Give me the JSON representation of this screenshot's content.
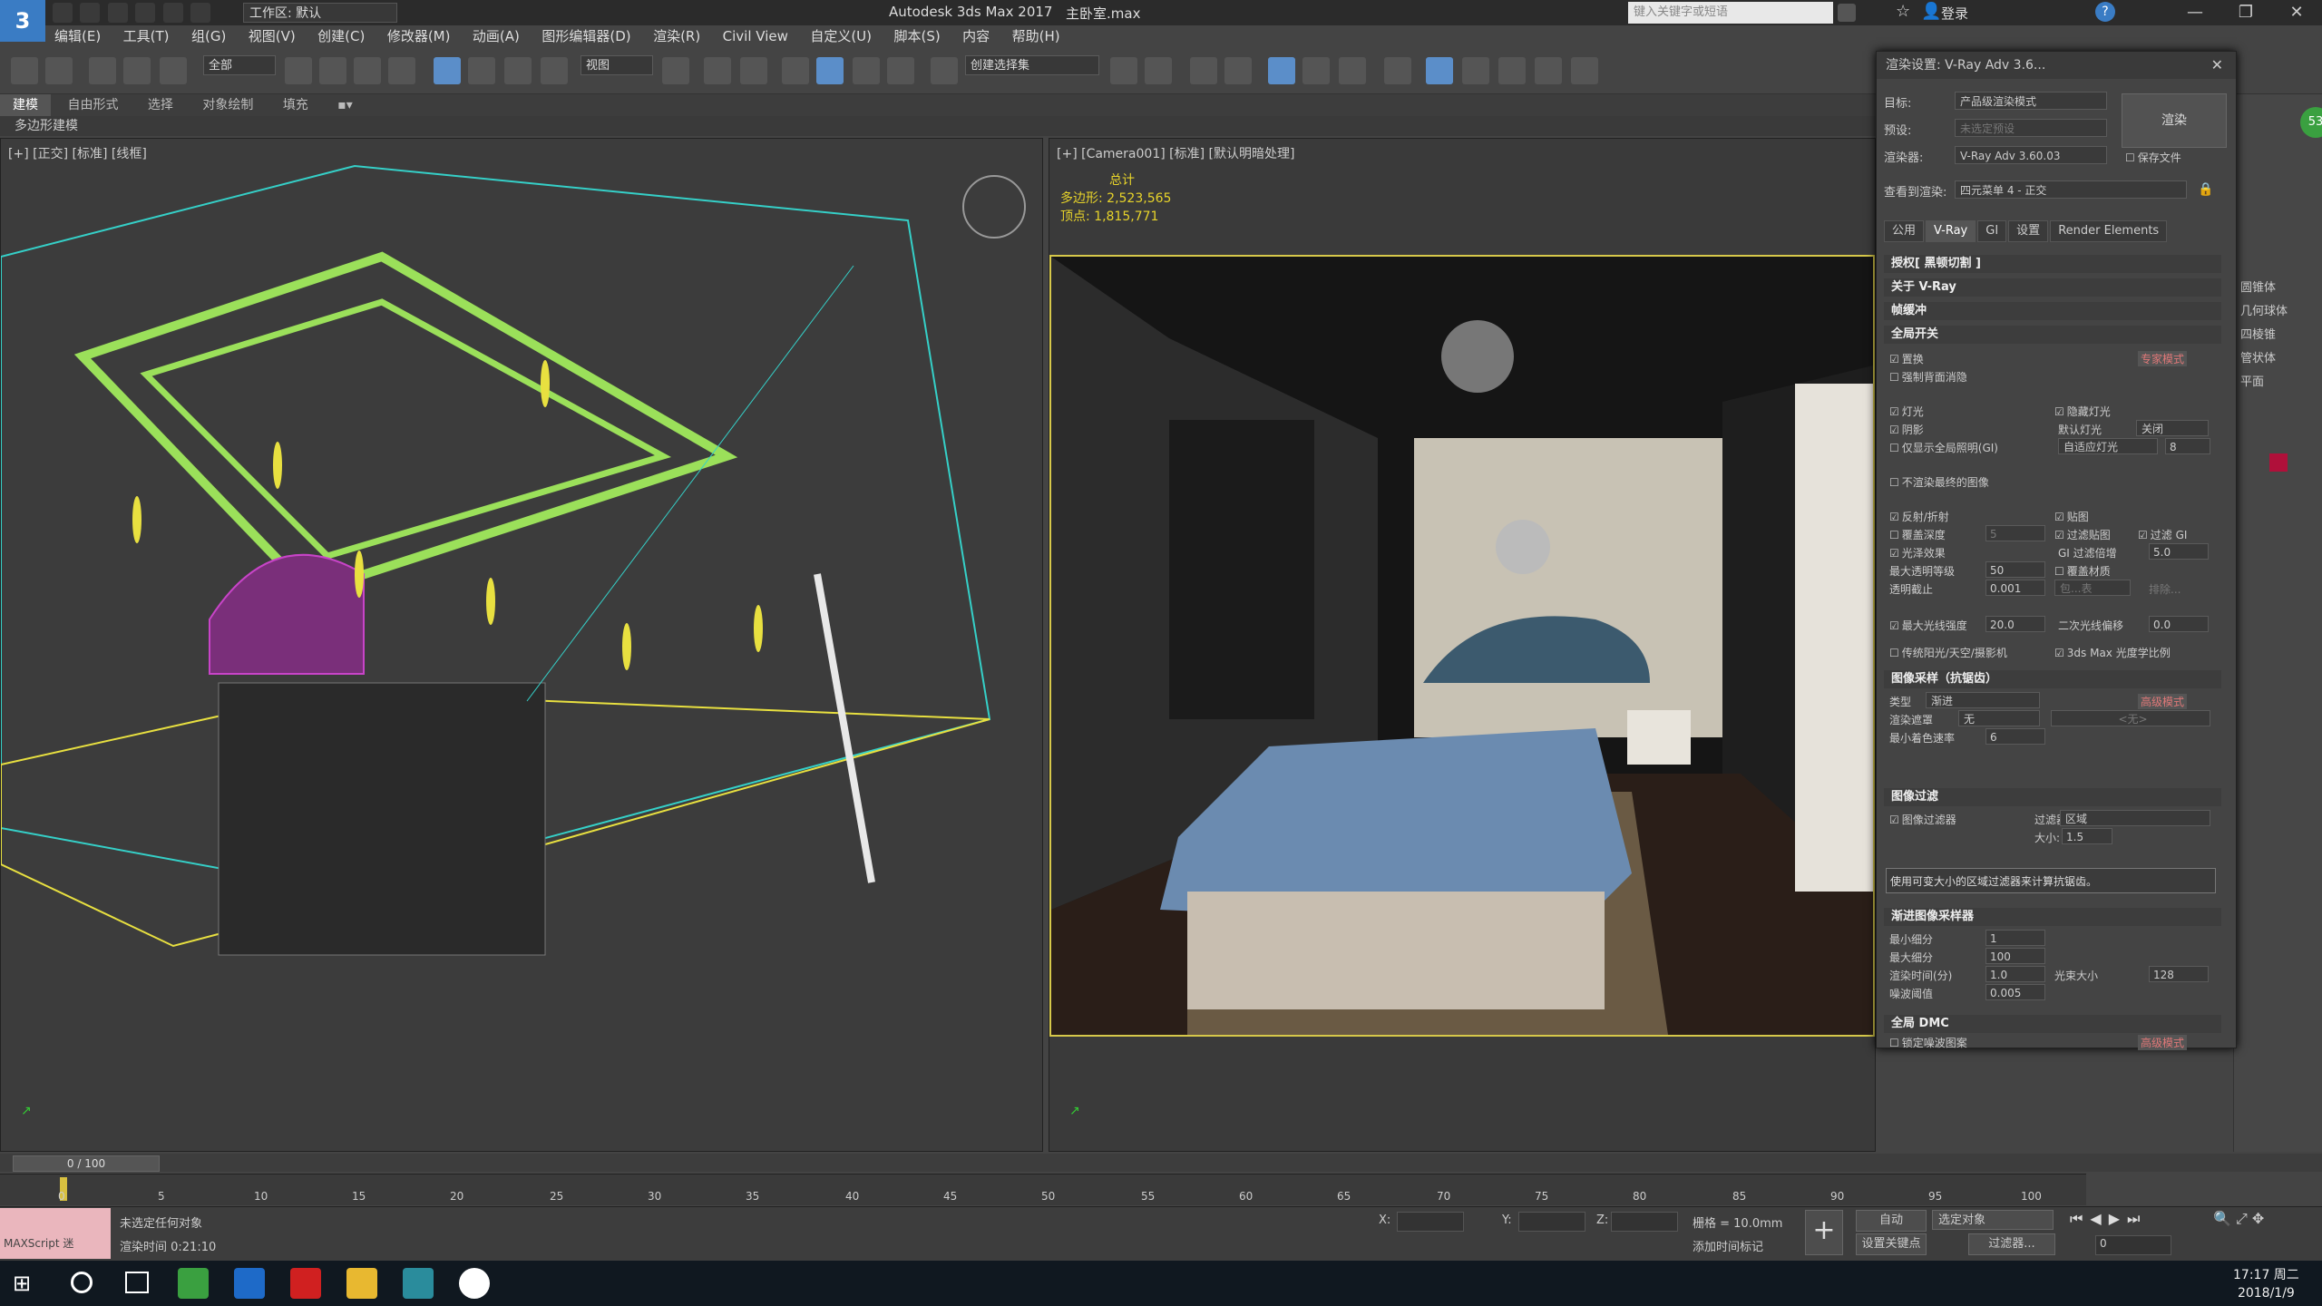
{
  "titlebar": {
    "app_logo": "3",
    "workspace_label": "工作区: 默认",
    "app_title": "Autodesk 3ds Max 2017",
    "file_name": "主卧室.max",
    "search_placeholder": "键入关键字或短语",
    "login_label": "登录",
    "window_controls": [
      "—",
      "❐",
      "✕"
    ]
  },
  "menu": [
    "编辑(E)",
    "工具(T)",
    "组(G)",
    "视图(V)",
    "创建(C)",
    "修改器(M)",
    "动画(A)",
    "图形编辑器(D)",
    "渲染(R)",
    "Civil View",
    "自定义(U)",
    "脚本(S)",
    "内容",
    "帮助(H)"
  ],
  "toolbar": {
    "filter_select": "全部",
    "ref_coord_select": "视图",
    "named_selection": "创建选择集"
  },
  "ribbon": {
    "tabs": [
      "建模",
      "自由形式",
      "选择",
      "对象绘制",
      "填充"
    ],
    "subtitle": "多边形建模"
  },
  "viewport_left": {
    "label": "[+] [正交] [标准] [线框]"
  },
  "viewport_right": {
    "label": "[+] [Camera001] [标准] [默认明暗处理]",
    "stats_title": "总计",
    "poly_label": "多边形:",
    "poly_value": "2,523,565",
    "vert_label": "顶点:",
    "vert_value": "1,815,771"
  },
  "render_dialog": {
    "title": "渲染设置: V-Ray Adv 3.6...",
    "target_label": "目标:",
    "target_value": "产品级渲染模式",
    "preset_label": "预设:",
    "preset_value": "未选定预设",
    "renderer_label": "渲染器:",
    "renderer_value": "V-Ray Adv 3.60.03",
    "save_file": "保存文件",
    "view_label": "查看到渲染:",
    "view_value": "四元菜单 4 - 正交",
    "render_button": "渲染",
    "tabs": [
      "公用",
      "V-Ray",
      "GI",
      "设置",
      "Render Elements"
    ],
    "sections": {
      "auth": "授权[ 黑顿切割 ]",
      "about": "关于 V-Ray",
      "framebuffer": "帧缓冲",
      "global": "全局开关",
      "image_sampler": "图像采样（抗锯齿）",
      "image_filter": "图像过滤",
      "progressive": "渐进图像采样器",
      "dmc": "全局 DMC"
    },
    "global": {
      "displacement": "置换",
      "expert_mode": "专家模式",
      "force_backface": "强制背面消隐",
      "lights": "灯光",
      "hidden_lights": "隐藏灯光",
      "shadows": "阴影",
      "default_lights_label": "默认灯光",
      "default_lights_value": "关闭",
      "gi_only": "仅显示全局照明(GI)",
      "auto_light": "自适应灯光",
      "auto_light_num": "8",
      "dont_render_final": "不渲染最终的图像",
      "reflect_refract": "反射/折射",
      "maps": "贴图",
      "override_depth": "覆盖深度",
      "override_depth_value": "5",
      "filter_maps": "过滤贴图",
      "filter_gi": "过滤 GI",
      "glossy": "光泽效果",
      "gi_filter_mult": "GI 过滤倍增",
      "gi_filter_mult_value": "5.0",
      "max_transp": "最大透明等级",
      "max_transp_value": "50",
      "override_mtl": "覆盖材质",
      "transp_cutoff": "透明截止",
      "transp_cutoff_value": "0.001",
      "include_value": "包...表",
      "exclude": "排除...",
      "max_ray_intensity": "最大光线强度",
      "max_ray_intensity_value": "20.0",
      "secondary_bias": "二次光线偏移",
      "secondary_bias_value": "0.0",
      "legacy_sun": "传统阳光/天空/摄影机",
      "photometric": "3ds Max 光度学比例"
    },
    "sampler": {
      "type_label": "类型",
      "type_value": "渐进",
      "expert_mode": "高级模式",
      "mask_label": "渲染遮罩",
      "mask_value": "无",
      "mask_none": "<无>",
      "min_shading_label": "最小着色速率",
      "min_shading_value": "6"
    },
    "filter": {
      "enable": "图像过滤器",
      "filter_label": "过滤器",
      "filter_value": "区域",
      "size_label": "大小:",
      "size_value": "1.5",
      "description": "使用可变大小的区域过滤器来计算抗锯齿。"
    },
    "progressive": {
      "min_sub_label": "最小细分",
      "min_sub_value": "1",
      "max_sub_label": "最大细分",
      "max_sub_value": "100",
      "time_label": "渲染时间(分)",
      "time_value": "1.0",
      "bundle_label": "光束大小",
      "bundle_value": "128",
      "noise_label": "噪波阈值",
      "noise_value": "0.005"
    },
    "dmc": {
      "lock": "锁定噪波图案",
      "expert_mode": "高级模式"
    }
  },
  "command_panel": {
    "items": [
      "圆锥体",
      "几何球体",
      "四棱锥",
      "管状体",
      "平面"
    ],
    "badge": "53"
  },
  "timeline": {
    "frame_display": "0 / 100",
    "ticks": [
      "0",
      "5",
      "10",
      "15",
      "20",
      "25",
      "30",
      "35",
      "40",
      "45",
      "50",
      "55",
      "60",
      "65",
      "70",
      "75",
      "80",
      "85",
      "90",
      "95",
      "100"
    ]
  },
  "status": {
    "maxscript_label": "MAXScript 迷",
    "selection_text": "未选定任何对象",
    "render_time": "渲染时间 0:21:10",
    "x_label": "X:",
    "y_label": "Y:",
    "z_label": "Z:",
    "grid_text": "栅格 = 10.0mm",
    "add_time_tag": "添加时间标记",
    "auto_key": "自动",
    "set_key": "设置关键点",
    "selected_object": "选定对象",
    "key_filters": "过滤器...",
    "frame_value": "0"
  },
  "taskbar": {
    "time": "17:17 周二",
    "date": "2018/1/9"
  },
  "colors": {
    "accent_blue": "#5b8ec9",
    "wire_green": "#9be05a",
    "wire_cyan": "#35d0c8",
    "wire_yellow": "#e8e040",
    "wire_magenta": "#c844c8",
    "render_border": "#d6c84a"
  }
}
